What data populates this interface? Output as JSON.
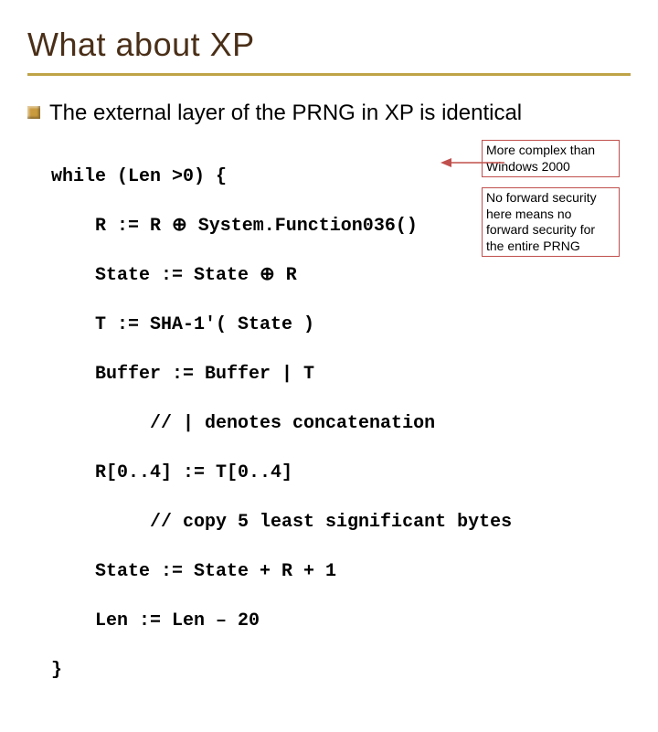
{
  "title": "What about XP",
  "bullet": "The external layer of the PRNG in XP is identical",
  "code": {
    "l0": "while (Len >0) {",
    "l1": "    R := R ⊕ System.Function036()",
    "l2": "    State := State ⊕ R",
    "l3": "    T := SHA-1'( State )",
    "l4": "    Buffer := Buffer | T",
    "l5": "         // | denotes concatenation",
    "l6": "    R[0..4] := T[0..4]",
    "l7": "         // copy 5 least significant bytes",
    "l8": "    State := State + R + 1",
    "l9": "    Len := Len – 20",
    "l10": "}"
  },
  "annotation1": "More complex than Windows 2000",
  "annotation2": "No forward security here means no forward security for the entire PRNG"
}
